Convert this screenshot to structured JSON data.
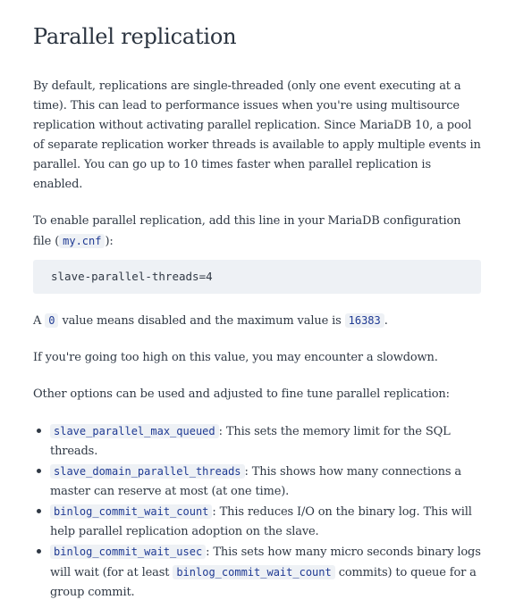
{
  "heading": "Parallel replication",
  "intro": "By default, replications are single-threaded (only one event executing at a time). This can lead to performance issues when you're using multisource replication without activating parallel replication. Since MariaDB 10, a pool of separate rep­lication worker threads is available to apply multiple events in parallel. You can go up to 10 times faster when parallel replication is enabled.",
  "enable": {
    "text_before": "To enable parallel replication, add this line in your MariaDB configuration file (",
    "file": "my.cnf",
    "text_after": "):"
  },
  "code_block": "slave-parallel-threads=4",
  "zero_note": {
    "prefix": "A ",
    "zero": "0",
    "middle": " value means disabled and the maximum value is ",
    "max": "16383",
    "suffix": "."
  },
  "slowdown": "If you're going too high on this value, you may encounter a slowdown.",
  "other_options": "Other options can be used and adjusted to fine tune parallel replication:",
  "options": [
    {
      "name": "slave_parallel_max_queued",
      "desc": ": This sets the memory limit for the SQL threads."
    },
    {
      "name": "slave_domain_parallel_threads",
      "desc": ": This shows how many connections a master can reserve at most (at one time)."
    },
    {
      "name": "binlog_commit_wait_count",
      "desc": ": This reduces I/O on the binary log. This will help parallel replication adoption on the slave."
    },
    {
      "name": "binlog_commit_wait_usec",
      "desc_before": ": This sets how many micro seconds binary logs will wait (for at least ",
      "ref": "binlog_commit_wait_count",
      "desc_after": " commits) to queue for a group commit."
    }
  ]
}
